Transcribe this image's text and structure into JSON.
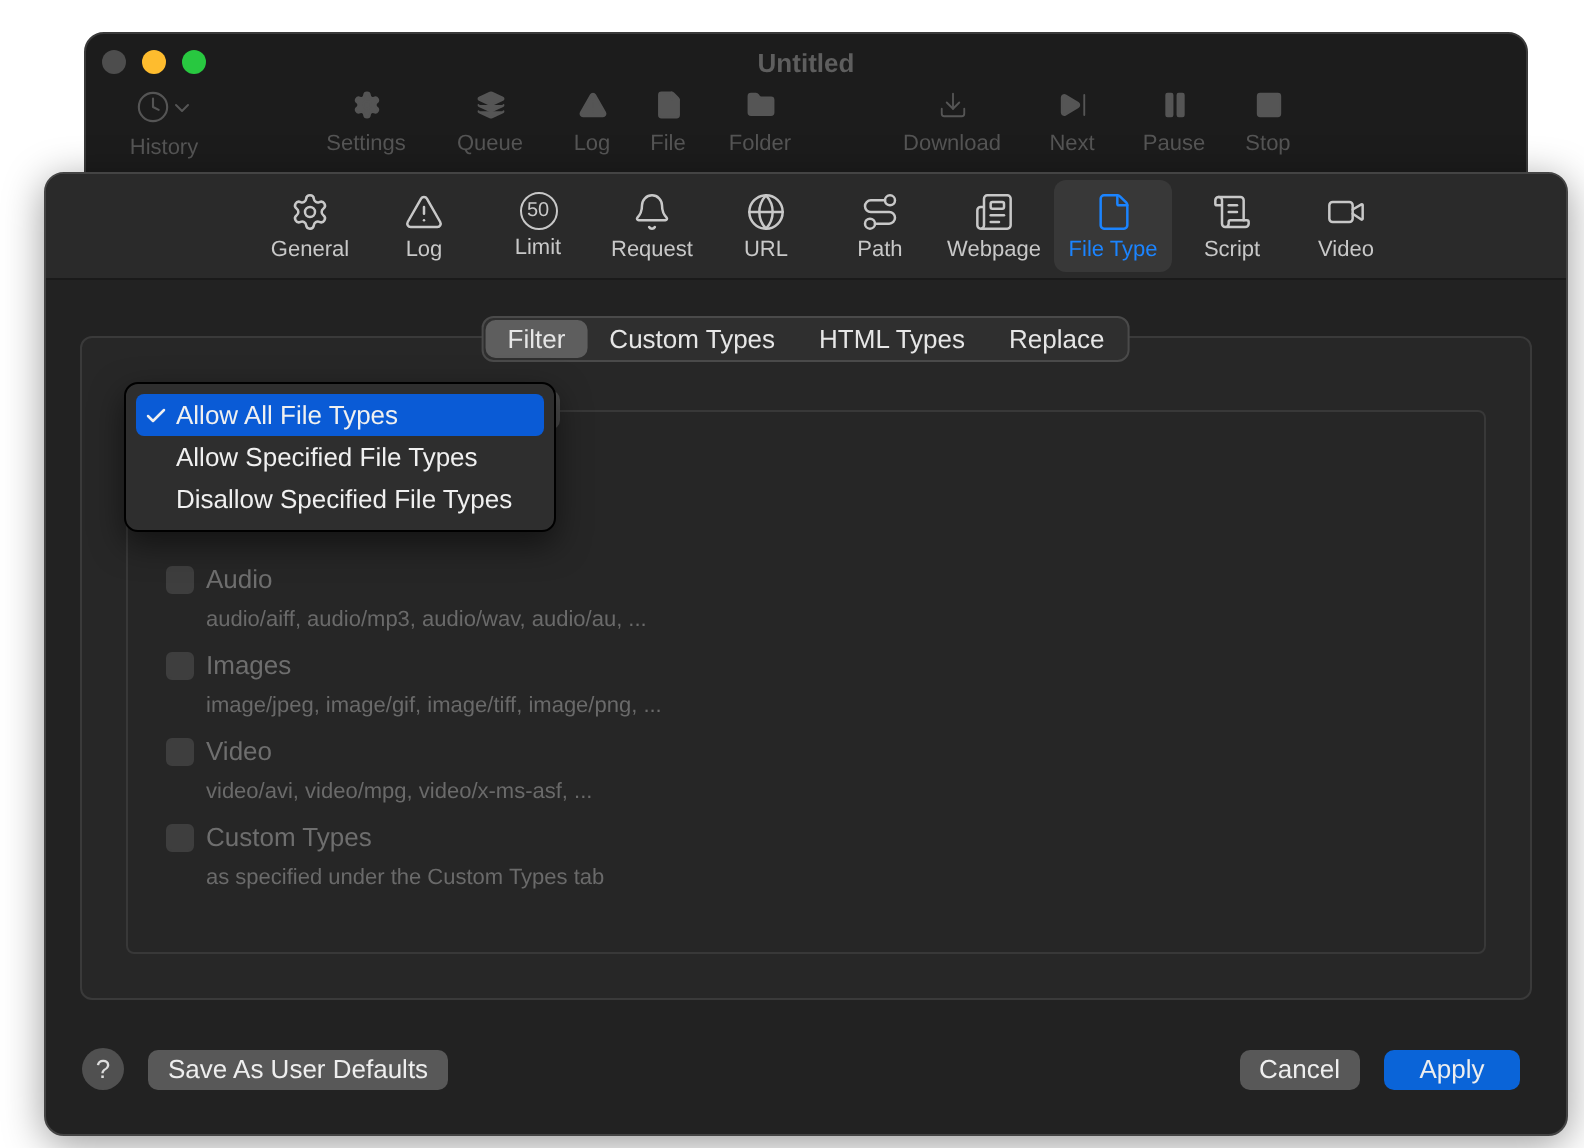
{
  "back_window": {
    "title": "Untitled",
    "toolbar": [
      {
        "label": "History"
      },
      {
        "label": "Settings"
      },
      {
        "label": "Queue"
      },
      {
        "label": "Log"
      },
      {
        "label": "File"
      },
      {
        "label": "Folder"
      },
      {
        "label": "Download"
      },
      {
        "label": "Next"
      },
      {
        "label": "Pause"
      },
      {
        "label": "Stop"
      }
    ]
  },
  "preferences": {
    "tabs": [
      {
        "label": "General",
        "selected": false
      },
      {
        "label": "Log",
        "selected": false
      },
      {
        "label": "Limit",
        "badge": "50",
        "selected": false
      },
      {
        "label": "Request",
        "selected": false
      },
      {
        "label": "URL",
        "selected": false
      },
      {
        "label": "Path",
        "selected": false
      },
      {
        "label": "Webpage",
        "selected": false
      },
      {
        "label": "File Type",
        "selected": true
      },
      {
        "label": "Script",
        "selected": false
      },
      {
        "label": "Video",
        "selected": false
      }
    ],
    "segments": [
      {
        "label": "Filter",
        "selected": true
      },
      {
        "label": "Custom Types",
        "selected": false
      },
      {
        "label": "HTML Types",
        "selected": false
      },
      {
        "label": "Replace",
        "selected": false
      }
    ],
    "filter_menu": [
      {
        "label": "Allow All File Types",
        "selected": true
      },
      {
        "label": "Allow Specified File Types",
        "selected": false
      },
      {
        "label": "Disallow Specified File Types",
        "selected": false
      }
    ],
    "categories": [
      {
        "label": "Audio",
        "checked": false,
        "disabled": true,
        "description": "audio/aiff, audio/mp3, audio/wav, audio/au, ..."
      },
      {
        "label": "Images",
        "checked": false,
        "disabled": true,
        "description": "image/jpeg, image/gif, image/tiff, image/png, ..."
      },
      {
        "label": "Video",
        "checked": false,
        "disabled": true,
        "description": "video/avi, video/mpg, video/x-ms-asf, ..."
      },
      {
        "label": "Custom Types",
        "checked": false,
        "disabled": true,
        "description": "as specified under the Custom Types tab"
      }
    ],
    "footer": {
      "help": "?",
      "buttons": [
        {
          "label": "Save As User Defaults",
          "kind": "secondary"
        },
        {
          "label": "Cancel",
          "kind": "secondary"
        },
        {
          "label": "Apply",
          "kind": "primary"
        }
      ]
    }
  }
}
